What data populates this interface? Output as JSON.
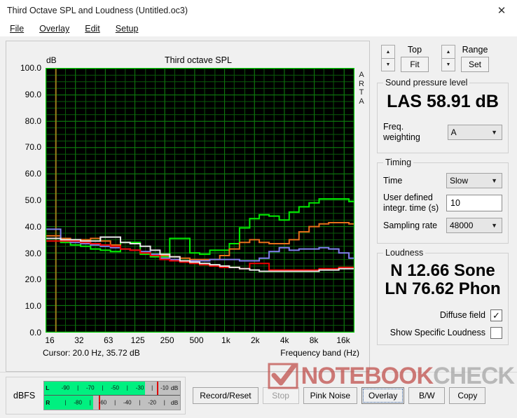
{
  "window": {
    "title": "Third Octave SPL and Loudness (Untitled.oc3)",
    "close_icon": "close-icon"
  },
  "menu": [
    {
      "label": "File",
      "accel": "F"
    },
    {
      "label": "Overlay",
      "accel": "O"
    },
    {
      "label": "Edit",
      "accel": "E"
    },
    {
      "label": "Setup",
      "accel": "S"
    }
  ],
  "chart_panel": {
    "title": "Third octave SPL",
    "y_unit": "dB",
    "watermark_vertical": "ARTA",
    "cursor_text": "Cursor:   20.0 Hz, 35.72 dB",
    "x_axis_title": "Frequency band (Hz)"
  },
  "controls": {
    "top_label": "Top",
    "fit_label": "Fit",
    "range_label": "Range",
    "set_label": "Set",
    "up_icon": "chevron-up-icon",
    "down_icon": "chevron-down-icon"
  },
  "spl": {
    "group_label": "Sound pressure level",
    "reading": "LAS 58.91 dB",
    "weighting_label": "Freq. weighting",
    "weighting_value": "A"
  },
  "timing": {
    "group_label": "Timing",
    "time_label": "Time",
    "time_value": "Slow",
    "integr_label_line1": "User defined",
    "integr_label_line2": "integr. time (s)",
    "integr_value": "10",
    "sampling_label": "Sampling rate",
    "sampling_value": "48000"
  },
  "loudness": {
    "group_label": "Loudness",
    "sone": "N 12.66 Sone",
    "phon": "LN 76.62 Phon",
    "diffuse_label": "Diffuse field",
    "diffuse_checked": "✓",
    "specific_label": "Show Specific Loudness",
    "specific_checked": ""
  },
  "meter": {
    "label": "dBFS",
    "unit": "dB",
    "left_channel": "L",
    "right_channel": "R",
    "left_ticks": [
      "-90",
      "|",
      "-70",
      "|",
      "-50",
      "|",
      "-30",
      "|",
      "-10"
    ],
    "right_ticks": [
      "|",
      "-80",
      "|",
      "-60",
      "|",
      "-40",
      "|",
      "-20",
      "|"
    ],
    "left_fill_pct": 74,
    "right_fill_pct": 36,
    "left_peak_pct": 83,
    "right_peak_pct": 40,
    "fill_color": "#00f080",
    "peak_color": "#e00000"
  },
  "buttons": [
    {
      "label": "Record/Reset",
      "state": "normal"
    },
    {
      "label": "Stop",
      "state": "disabled"
    },
    {
      "label": "Pink Noise",
      "state": "normal"
    },
    {
      "label": "Overlay",
      "state": "focused"
    },
    {
      "label": "B/W",
      "state": "normal"
    },
    {
      "label": "Copy",
      "state": "normal"
    }
  ],
  "watermark": {
    "bold_text": "NOTEBOOK",
    "light_text": "CHECK",
    "check_icon": "checkmark-icon",
    "bold_color": "#c0504d",
    "light_color": "#a6a6a6"
  },
  "chart_data": {
    "type": "line",
    "title": "Third octave SPL",
    "xlabel": "Frequency band (Hz)",
    "ylabel": "dB",
    "ylim": [
      0,
      100
    ],
    "yticks": [
      "0.0",
      "10.0",
      "20.0",
      "30.0",
      "40.0",
      "50.0",
      "60.0",
      "70.0",
      "80.0",
      "90.0",
      "100.0"
    ],
    "xticks": [
      "16",
      "32",
      "63",
      "125",
      "250",
      "500",
      "1k",
      "2k",
      "4k",
      "8k",
      "16k"
    ],
    "grid": true,
    "plot_bg": "#000000",
    "grid_color": "#0f7a0f",
    "cursor_line": {
      "freq_hz": 20.0,
      "value_db": 35.72,
      "color": "#9a7d1a"
    },
    "x": [
      16,
      20,
      25,
      31.5,
      40,
      50,
      63,
      80,
      100,
      125,
      160,
      200,
      250,
      315,
      400,
      500,
      630,
      800,
      1000,
      1250,
      1600,
      2000,
      2500,
      3150,
      4000,
      5000,
      6300,
      8000,
      10000,
      12500,
      16000,
      20000
    ],
    "series": [
      {
        "name": "green",
        "color": "#00ee00",
        "values": [
          35.5,
          35.5,
          34.0,
          33.0,
          32.5,
          31.5,
          31.0,
          30.5,
          34.0,
          34.0,
          29.5,
          28.5,
          28.5,
          35.5,
          35.5,
          30.0,
          29.5,
          31.0,
          31.0,
          33.5,
          39.5,
          43.0,
          44.5,
          44.0,
          42.5,
          45.5,
          47.5,
          49.0,
          50.5,
          50.5,
          50.5,
          49.5
        ]
      },
      {
        "name": "orange",
        "color": "#e8701a",
        "values": [
          36.5,
          36.5,
          35.5,
          35.0,
          35.0,
          35.5,
          34.5,
          33.0,
          31.5,
          31.0,
          30.0,
          29.5,
          29.0,
          28.5,
          28.0,
          27.5,
          27.5,
          27.5,
          29.0,
          31.5,
          34.0,
          35.0,
          34.0,
          33.5,
          33.5,
          35.0,
          38.0,
          40.0,
          41.0,
          41.5,
          41.5,
          41.0
        ]
      },
      {
        "name": "blue",
        "color": "#8080ee",
        "values": [
          39.0,
          39.0,
          34.5,
          34.0,
          33.5,
          33.0,
          32.5,
          32.0,
          31.5,
          31.0,
          30.5,
          29.5,
          28.0,
          27.5,
          27.0,
          27.0,
          27.0,
          27.5,
          27.5,
          27.5,
          27.0,
          27.0,
          28.0,
          30.5,
          32.0,
          31.0,
          31.5,
          31.5,
          32.0,
          31.5,
          30.0,
          28.0
        ]
      },
      {
        "name": "red",
        "color": "#ee0000",
        "values": [
          34.5,
          34.5,
          34.5,
          34.5,
          34.0,
          33.5,
          33.0,
          32.5,
          31.5,
          31.0,
          30.0,
          29.0,
          27.5,
          27.0,
          26.5,
          26.0,
          25.5,
          25.0,
          24.5,
          24.5,
          24.0,
          26.0,
          26.0,
          23.5,
          23.5,
          23.5,
          23.5,
          23.5,
          24.0,
          24.0,
          24.5,
          24.5
        ]
      },
      {
        "name": "white",
        "color": "#e8e8e8",
        "values": [
          35.5,
          35.5,
          35.0,
          35.0,
          34.5,
          34.5,
          36.0,
          36.0,
          34.0,
          33.5,
          32.5,
          31.0,
          29.5,
          28.5,
          27.0,
          26.5,
          26.0,
          25.5,
          25.0,
          24.5,
          24.0,
          23.5,
          23.0,
          23.0,
          23.0,
          23.0,
          23.0,
          23.0,
          23.5,
          23.5,
          24.0,
          24.0
        ]
      }
    ]
  }
}
